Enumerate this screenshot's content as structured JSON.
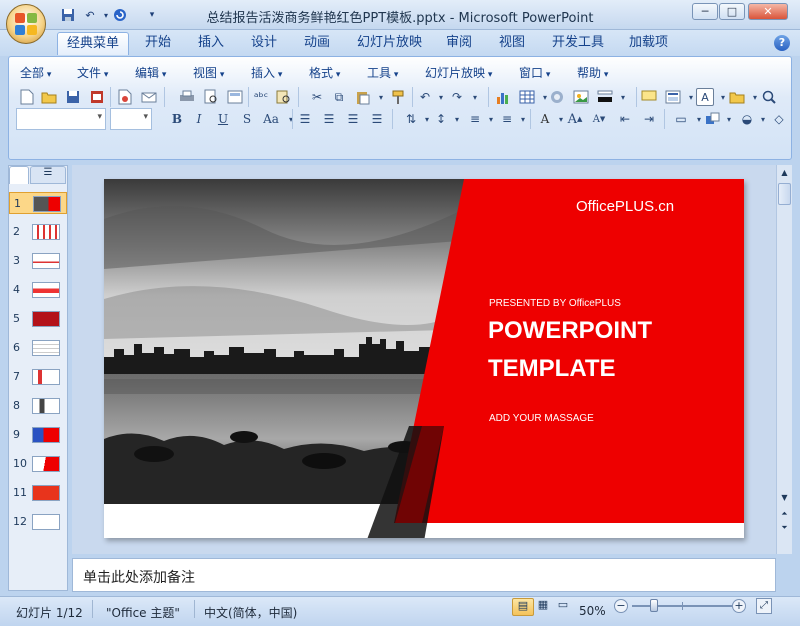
{
  "window": {
    "title": "总结报告活泼商务鲜艳红色PPT模板.pptx - Microsoft PowerPoint",
    "minimize_label": "─",
    "maximize_label": "□",
    "close_label": "✕"
  },
  "quick_access": {
    "save_icon": "save-icon",
    "undo_icon": "undo-icon",
    "redo_icon": "redo-icon",
    "customize_icon": "customize-qat-icon"
  },
  "ribbon_tabs": [
    {
      "label": "经典菜单",
      "active": true
    },
    {
      "label": "开始"
    },
    {
      "label": "插入"
    },
    {
      "label": "设计"
    },
    {
      "label": "动画"
    },
    {
      "label": "幻灯片放映"
    },
    {
      "label": "审阅"
    },
    {
      "label": "视图"
    },
    {
      "label": "开发工具"
    },
    {
      "label": "加载项"
    }
  ],
  "help_label": "?",
  "classic_menus": [
    "全部",
    "文件",
    "编辑",
    "视图",
    "插入",
    "格式",
    "工具",
    "幻灯片放映",
    "窗口",
    "帮助"
  ],
  "format_buttons": {
    "bold": "B",
    "italic": "I",
    "underline": "U",
    "shadow": "S",
    "change_case": "Aa",
    "font_color": "A"
  },
  "slides_pane": {
    "slide_numbers": [
      "1",
      "2",
      "3",
      "4",
      "5",
      "6",
      "7",
      "8",
      "9",
      "10",
      "11",
      "12"
    ],
    "selected": 1
  },
  "slide": {
    "brand": "OfficePLUS.cn",
    "presented_by": "PRESENTED BY OfficePLUS",
    "title_line1": "POWERPOINT",
    "title_line2": "TEMPLATE",
    "subtitle": "ADD YOUR MASSAGE"
  },
  "notes_placeholder": "单击此处添加备注",
  "status": {
    "slide_info": "幻灯片 1/12",
    "theme": "\"Office 主题\"",
    "language": "中文(简体，中国)",
    "zoom": "50%",
    "zoom_level": 0.5
  },
  "colors": {
    "accent_red": "#ee0000",
    "ribbon_blue": "#c4d9f1",
    "tab_text": "#15428b"
  }
}
